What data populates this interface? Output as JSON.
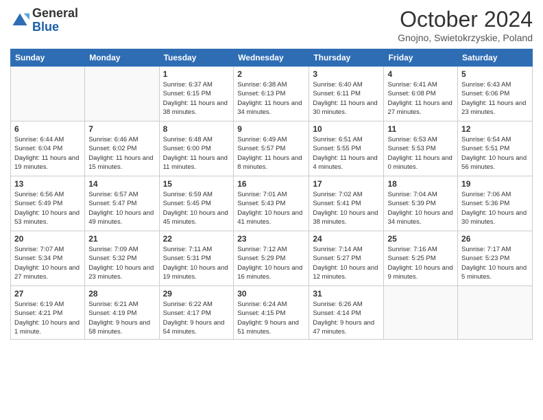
{
  "header": {
    "logo_general": "General",
    "logo_blue": "Blue",
    "month_title": "October 2024",
    "location": "Gnojno, Swietokrzyskie, Poland"
  },
  "weekdays": [
    "Sunday",
    "Monday",
    "Tuesday",
    "Wednesday",
    "Thursday",
    "Friday",
    "Saturday"
  ],
  "weeks": [
    [
      {
        "day": "",
        "info": ""
      },
      {
        "day": "",
        "info": ""
      },
      {
        "day": "1",
        "info": "Sunrise: 6:37 AM\nSunset: 6:15 PM\nDaylight: 11 hours and 38 minutes."
      },
      {
        "day": "2",
        "info": "Sunrise: 6:38 AM\nSunset: 6:13 PM\nDaylight: 11 hours and 34 minutes."
      },
      {
        "day": "3",
        "info": "Sunrise: 6:40 AM\nSunset: 6:11 PM\nDaylight: 11 hours and 30 minutes."
      },
      {
        "day": "4",
        "info": "Sunrise: 6:41 AM\nSunset: 6:08 PM\nDaylight: 11 hours and 27 minutes."
      },
      {
        "day": "5",
        "info": "Sunrise: 6:43 AM\nSunset: 6:06 PM\nDaylight: 11 hours and 23 minutes."
      }
    ],
    [
      {
        "day": "6",
        "info": "Sunrise: 6:44 AM\nSunset: 6:04 PM\nDaylight: 11 hours and 19 minutes."
      },
      {
        "day": "7",
        "info": "Sunrise: 6:46 AM\nSunset: 6:02 PM\nDaylight: 11 hours and 15 minutes."
      },
      {
        "day": "8",
        "info": "Sunrise: 6:48 AM\nSunset: 6:00 PM\nDaylight: 11 hours and 11 minutes."
      },
      {
        "day": "9",
        "info": "Sunrise: 6:49 AM\nSunset: 5:57 PM\nDaylight: 11 hours and 8 minutes."
      },
      {
        "day": "10",
        "info": "Sunrise: 6:51 AM\nSunset: 5:55 PM\nDaylight: 11 hours and 4 minutes."
      },
      {
        "day": "11",
        "info": "Sunrise: 6:53 AM\nSunset: 5:53 PM\nDaylight: 11 hours and 0 minutes."
      },
      {
        "day": "12",
        "info": "Sunrise: 6:54 AM\nSunset: 5:51 PM\nDaylight: 10 hours and 56 minutes."
      }
    ],
    [
      {
        "day": "13",
        "info": "Sunrise: 6:56 AM\nSunset: 5:49 PM\nDaylight: 10 hours and 53 minutes."
      },
      {
        "day": "14",
        "info": "Sunrise: 6:57 AM\nSunset: 5:47 PM\nDaylight: 10 hours and 49 minutes."
      },
      {
        "day": "15",
        "info": "Sunrise: 6:59 AM\nSunset: 5:45 PM\nDaylight: 10 hours and 45 minutes."
      },
      {
        "day": "16",
        "info": "Sunrise: 7:01 AM\nSunset: 5:43 PM\nDaylight: 10 hours and 41 minutes."
      },
      {
        "day": "17",
        "info": "Sunrise: 7:02 AM\nSunset: 5:41 PM\nDaylight: 10 hours and 38 minutes."
      },
      {
        "day": "18",
        "info": "Sunrise: 7:04 AM\nSunset: 5:39 PM\nDaylight: 10 hours and 34 minutes."
      },
      {
        "day": "19",
        "info": "Sunrise: 7:06 AM\nSunset: 5:36 PM\nDaylight: 10 hours and 30 minutes."
      }
    ],
    [
      {
        "day": "20",
        "info": "Sunrise: 7:07 AM\nSunset: 5:34 PM\nDaylight: 10 hours and 27 minutes."
      },
      {
        "day": "21",
        "info": "Sunrise: 7:09 AM\nSunset: 5:32 PM\nDaylight: 10 hours and 23 minutes."
      },
      {
        "day": "22",
        "info": "Sunrise: 7:11 AM\nSunset: 5:31 PM\nDaylight: 10 hours and 19 minutes."
      },
      {
        "day": "23",
        "info": "Sunrise: 7:12 AM\nSunset: 5:29 PM\nDaylight: 10 hours and 16 minutes."
      },
      {
        "day": "24",
        "info": "Sunrise: 7:14 AM\nSunset: 5:27 PM\nDaylight: 10 hours and 12 minutes."
      },
      {
        "day": "25",
        "info": "Sunrise: 7:16 AM\nSunset: 5:25 PM\nDaylight: 10 hours and 9 minutes."
      },
      {
        "day": "26",
        "info": "Sunrise: 7:17 AM\nSunset: 5:23 PM\nDaylight: 10 hours and 5 minutes."
      }
    ],
    [
      {
        "day": "27",
        "info": "Sunrise: 6:19 AM\nSunset: 4:21 PM\nDaylight: 10 hours and 1 minute."
      },
      {
        "day": "28",
        "info": "Sunrise: 6:21 AM\nSunset: 4:19 PM\nDaylight: 9 hours and 58 minutes."
      },
      {
        "day": "29",
        "info": "Sunrise: 6:22 AM\nSunset: 4:17 PM\nDaylight: 9 hours and 54 minutes."
      },
      {
        "day": "30",
        "info": "Sunrise: 6:24 AM\nSunset: 4:15 PM\nDaylight: 9 hours and 51 minutes."
      },
      {
        "day": "31",
        "info": "Sunrise: 6:26 AM\nSunset: 4:14 PM\nDaylight: 9 hours and 47 minutes."
      },
      {
        "day": "",
        "info": ""
      },
      {
        "day": "",
        "info": ""
      }
    ]
  ]
}
